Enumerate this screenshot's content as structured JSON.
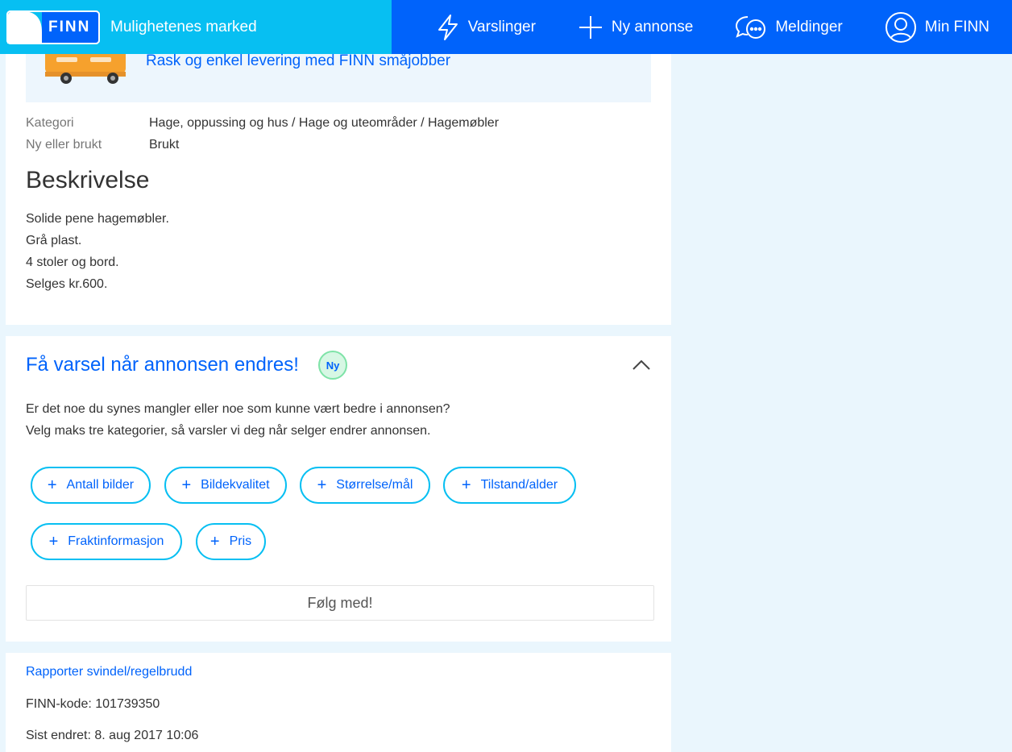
{
  "brand": {
    "logo_text": "FINN",
    "tagline": "Mulighetenes marked"
  },
  "nav": [
    {
      "label": "Varslinger",
      "icon": "lightning-icon"
    },
    {
      "label": "Ny annonse",
      "icon": "plus-icon"
    },
    {
      "label": "Meldinger",
      "icon": "chat-bubbles-icon"
    },
    {
      "label": "Min FINN",
      "icon": "user-circle-icon"
    }
  ],
  "delivery": {
    "link_text": "Rask og enkel levering med FINN småjobber",
    "icon": "van-icon"
  },
  "facts": [
    {
      "key": "Kategori",
      "value": "Hage, oppussing og hus / Hage og uteområder / Hagemøbler"
    },
    {
      "key": "Ny eller brukt",
      "value": "Brukt"
    }
  ],
  "description": {
    "heading": "Beskrivelse",
    "lines": [
      "Solide pene hagemøbler.",
      "Grå plast.",
      "4 stoler og bord.",
      "Selges kr.600."
    ]
  },
  "alert": {
    "title": "Få varsel når annonsen endres!",
    "badge": "Ny",
    "text_lines": [
      "Er det noe du synes mangler eller noe som kunne vært bedre i annonsen?",
      "Velg maks tre kategorier, så varsler vi deg når selger endrer annonsen."
    ],
    "chips": [
      "Antall bilder",
      "Bildekvalitet",
      "Størrelse/mål",
      "Tilstand/alder",
      "Fraktinformasjon",
      "Pris"
    ],
    "follow_label": "Følg med!"
  },
  "footer": {
    "report_link": "Rapporter svindel/regelbrudd",
    "finn_code": "FINN-kode: 101739350",
    "last_changed": "Sist endret: 8. aug 2017 10:06"
  },
  "colors": {
    "brand_cyan": "#07bff2",
    "brand_blue": "#0063fb",
    "page_bg": "#eaf6fd"
  }
}
